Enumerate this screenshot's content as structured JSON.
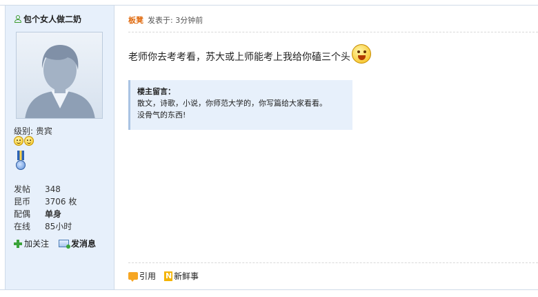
{
  "user": {
    "name": "包个女人做二奶",
    "level_label": "级别: 贵宾",
    "stats": [
      {
        "label": "发帖",
        "value": "348",
        "bold": false
      },
      {
        "label": "昆币",
        "value": "3706 枚",
        "bold": false
      },
      {
        "label": "配偶",
        "value": "单身",
        "bold": true
      },
      {
        "label": "在线",
        "value": "85小时",
        "bold": false
      }
    ],
    "actions": {
      "follow": "加关注",
      "message": "发消息"
    }
  },
  "post": {
    "author": "板凳",
    "posted_at": "发表于: 3分钟前",
    "content": "老师你去考考看，苏大或上师能考上我给你磕三个头",
    "quote": {
      "title": "楼主留言：",
      "line1": "散文，诗歌，小说，你师范大学的，你写篇给大家看看。",
      "line2": "没骨气的东西!"
    },
    "footer": {
      "quote_button": "引用",
      "news_button": "新鲜事"
    }
  },
  "icons": {
    "user": "user-icon",
    "follow": "plus-icon",
    "message": "message-icon",
    "quote": "quote-icon",
    "news": "news-icon",
    "emoji": "laughing-emoji-icon"
  },
  "colors": {
    "author": "#e06a0e",
    "sidebar_bg": "#e7f0fb",
    "quote_bg": "#e7f0fb"
  }
}
